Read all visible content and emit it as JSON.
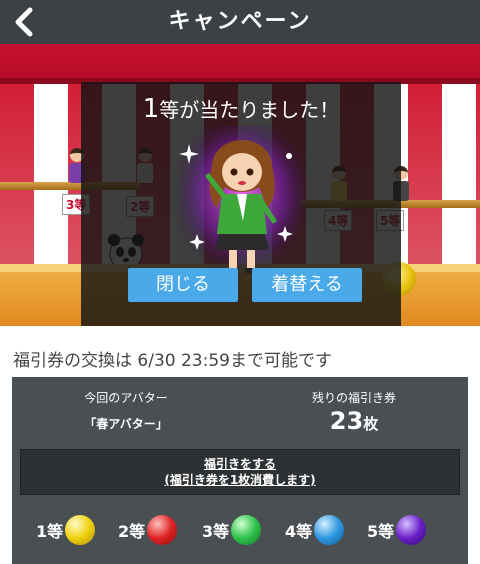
{
  "header": {
    "title": "キャンペーン"
  },
  "scene": {
    "tags": [
      "2等",
      "3等",
      "4等",
      "5等"
    ]
  },
  "dialog": {
    "title_number": "1",
    "title_rest": "等が当たりました！",
    "close_label": "閉じる",
    "change_label": "着替える"
  },
  "info": {
    "exchange_text": "福引券の交換は 6/30 23:59まで可能です"
  },
  "panel": {
    "current_avatar_label": "今回のアバター",
    "avatar_name": "「春アバター」",
    "remaining_label": "残りの福引き券",
    "ticket_count": "23",
    "ticket_unit": "枚",
    "draw_line1": "福引きをする",
    "draw_line2": "(福引き券を1枚消費します)"
  },
  "prizes": [
    {
      "label": "1等",
      "color": "gold"
    },
    {
      "label": "2等",
      "color": "red"
    },
    {
      "label": "3等",
      "color": "green"
    },
    {
      "label": "4等",
      "color": "blue"
    },
    {
      "label": "5等",
      "color": "purple"
    }
  ],
  "colors": {
    "header_bg": "#3b4144",
    "button_blue": "#4aa9e8",
    "panel_bg": "#4a4f53",
    "curtain_red": "#d21f35"
  }
}
